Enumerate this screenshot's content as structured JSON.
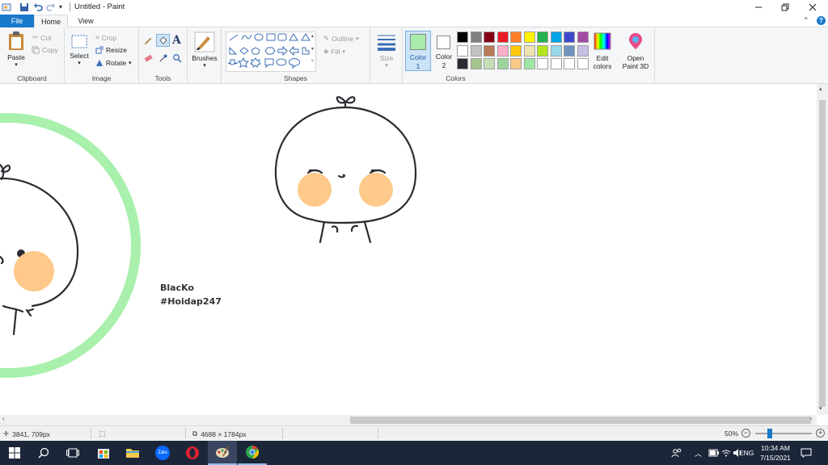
{
  "window": {
    "title": "Untitled - Paint"
  },
  "tabs": {
    "file": "File",
    "home": "Home",
    "view": "View"
  },
  "ribbon": {
    "clipboard": {
      "label": "Clipboard",
      "paste": "Paste",
      "cut": "Cut",
      "copy": "Copy"
    },
    "image": {
      "label": "Image",
      "select": "Select",
      "crop": "Crop",
      "resize": "Resize",
      "rotate": "Rotate"
    },
    "tools": {
      "label": "Tools"
    },
    "brushes": {
      "label": "Brushes"
    },
    "shapes": {
      "label": "Shapes",
      "outline": "Outline",
      "fill": "Fill"
    },
    "size": {
      "label": "Size"
    },
    "colors": {
      "label": "Colors",
      "color1": "Color 1",
      "color1_a": "Color",
      "color1_b": "1",
      "color2_a": "Color",
      "color2_b": "2",
      "color1_value": "#a8ecab",
      "color2_value": "#ffffff",
      "edit_a": "Edit",
      "edit_b": "colors",
      "palette": [
        "#000000",
        "#7f7f7f",
        "#880015",
        "#ed1c24",
        "#ff7f27",
        "#fff200",
        "#22b14c",
        "#00a2e8",
        "#3f48cc",
        "#a349a4",
        "#ffffff",
        "#c3c3c3",
        "#b97a57",
        "#ffaec9",
        "#ffc90e",
        "#efe4b0",
        "#b5e61d",
        "#99d9ea",
        "#7092be",
        "#c8bfe7",
        "#2b2b33",
        "#a7c38f",
        "#c6dfb6",
        "#9cd59c",
        "#f9c988",
        "#9ee8a6",
        "#ffffff",
        "#ffffff",
        "#ffffff",
        "#ffffff"
      ]
    },
    "paint3d": {
      "a": "Open",
      "b": "Paint 3D"
    }
  },
  "canvas_text": {
    "line1": "BlacKo",
    "line2": "#Hoidap247"
  },
  "status": {
    "cursor": "3841, 709px",
    "image_size": "4688 × 1784px",
    "zoom": "50%"
  },
  "taskbar": {
    "lang": "ENG",
    "time": "10:34 AM",
    "date": "7/15/2021",
    "zalo": "Zalo"
  }
}
